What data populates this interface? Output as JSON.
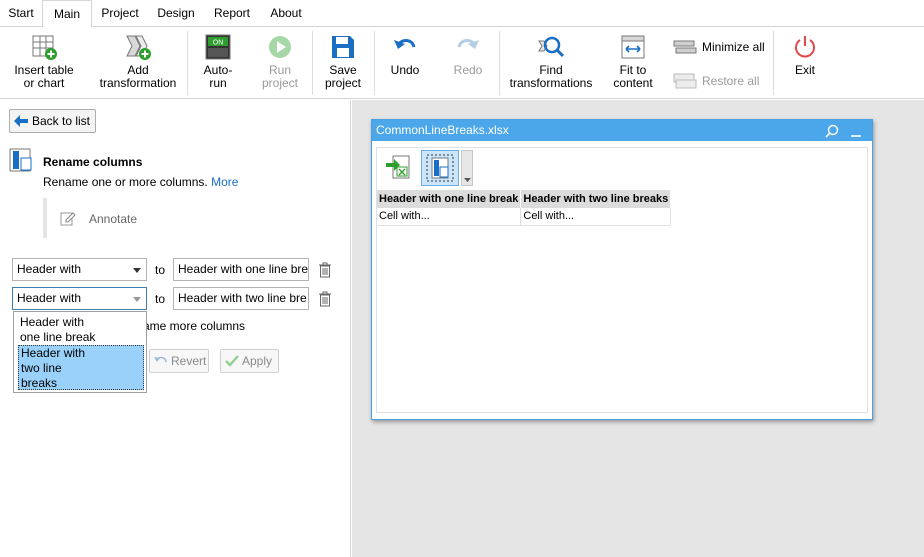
{
  "menu": {
    "tabs": [
      {
        "label": "Start"
      },
      {
        "label": "Main"
      },
      {
        "label": "Project"
      },
      {
        "label": "Design"
      },
      {
        "label": "Report"
      },
      {
        "label": "About"
      }
    ],
    "active": "Main"
  },
  "ribbon": {
    "insert_table": "Insert table\nor chart",
    "add_transformation": "Add\ntransformation",
    "auto_run": "Auto-\nrun",
    "auto_run_badge": "ON",
    "run_project": "Run\nproject",
    "save_project": "Save\nproject",
    "undo": "Undo",
    "redo": "Redo",
    "find_transformations": "Find\ntransformations",
    "fit_to_content": "Fit to\ncontent",
    "minimize_all": "Minimize all",
    "restore_all": "Restore all",
    "exit": "Exit"
  },
  "panel": {
    "back_label": "Back to list",
    "title": "Rename columns",
    "description": "Rename one or more columns.",
    "more_link": "More",
    "annotate": "Annotate",
    "rows": [
      {
        "from": "Header with",
        "to_word": "to",
        "to_value": "Header with one line bre"
      },
      {
        "from": "Header with",
        "to_word": "to",
        "to_value": "Header with two line bre"
      }
    ],
    "rename_more": "ame more columns",
    "revert": "Revert",
    "apply": "Apply",
    "dropdown_options": [
      {
        "lines": [
          "Header with",
          "one line break"
        ]
      },
      {
        "lines": [
          "Header with",
          "two line",
          "breaks"
        ]
      }
    ]
  },
  "preview": {
    "title": "CommonLineBreaks.xlsx",
    "columns": [
      "Header with one line break",
      "Header with two line breaks"
    ],
    "rows": [
      [
        "Cell with...",
        "Cell with..."
      ]
    ]
  },
  "colors": {
    "accent": "#4ba7ea",
    "selection": "#99d1fb",
    "link": "#1a6fc4",
    "green": "#2e9e2e"
  }
}
